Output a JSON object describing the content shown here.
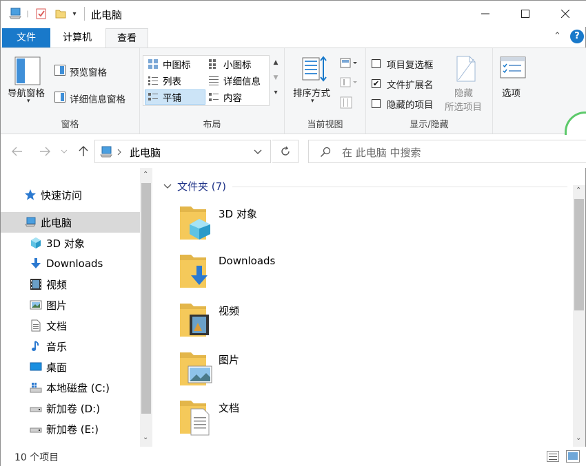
{
  "window": {
    "title": "此电脑"
  },
  "tabs": {
    "file": "文件",
    "computer": "计算机",
    "view": "查看"
  },
  "ribbon": {
    "panes": {
      "nav_pane": "导航窗格",
      "preview_pane": "预览窗格",
      "details_pane": "详细信息窗格",
      "label": "窗格"
    },
    "layout": {
      "medium_icons": "中图标",
      "small_icons": "小图标",
      "list": "列表",
      "details": "详细信息",
      "tiles": "平铺",
      "content": "内容",
      "label": "布局"
    },
    "current_view": {
      "sort_by": "排序方式",
      "label": "当前视图"
    },
    "show_hide": {
      "item_checkboxes": "项目复选框",
      "item_checkboxes_checked": false,
      "file_extensions": "文件扩展名",
      "file_extensions_checked": true,
      "hidden_items": "隐藏的项目",
      "hidden_items_checked": false,
      "hide_selected_line1": "隐藏",
      "hide_selected_line2": "所选项目",
      "label": "显示/隐藏"
    },
    "options": "选项"
  },
  "address": {
    "path": "此电脑",
    "search_placeholder": "在 此电脑 中搜索"
  },
  "sidebar": {
    "items": [
      {
        "label": "快速访问"
      },
      {
        "label": "此电脑"
      },
      {
        "label": "3D 对象"
      },
      {
        "label": "Downloads"
      },
      {
        "label": "视频"
      },
      {
        "label": "图片"
      },
      {
        "label": "文档"
      },
      {
        "label": "音乐"
      },
      {
        "label": "桌面"
      },
      {
        "label": "本地磁盘 (C:)"
      },
      {
        "label": "新加卷 (D:)"
      },
      {
        "label": "新加卷 (E:)"
      }
    ]
  },
  "content": {
    "group_title": "文件夹 (7)",
    "folders": [
      {
        "label": "3D 对象"
      },
      {
        "label": "Downloads"
      },
      {
        "label": "视频"
      },
      {
        "label": "图片"
      },
      {
        "label": "文档"
      }
    ]
  },
  "status": {
    "item_count": "10 个项目"
  },
  "colors": {
    "accent": "#1979ca",
    "folder": "#f5c95a",
    "selection": "#cce4f7"
  }
}
